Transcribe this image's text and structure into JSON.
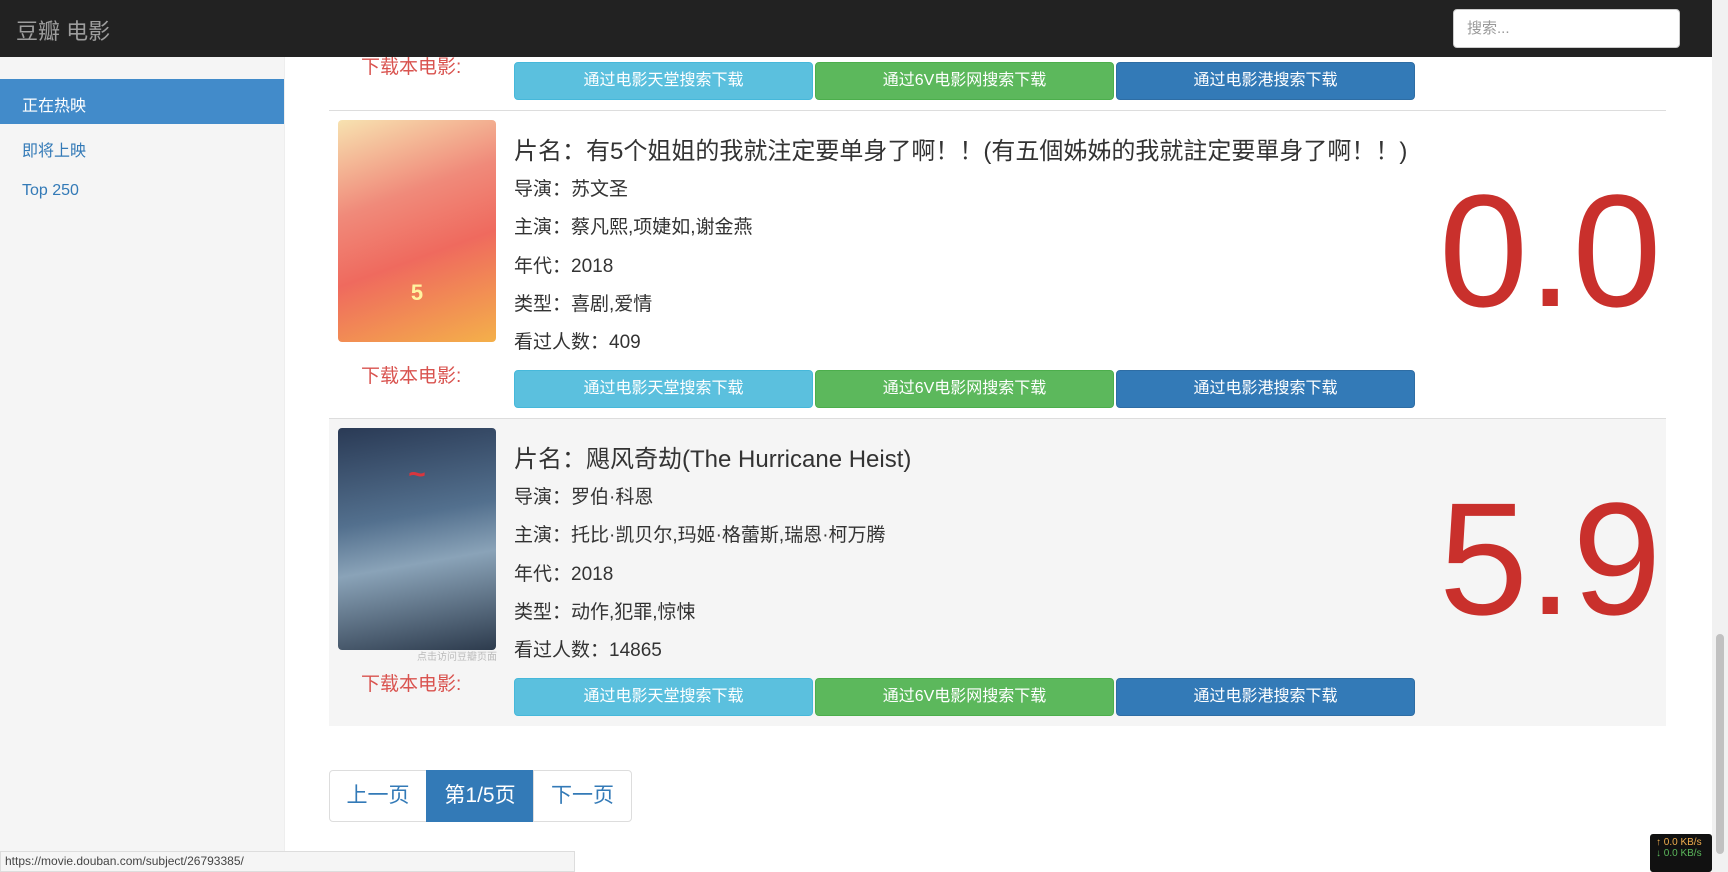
{
  "navbar": {
    "brand": "豆瓣 电影",
    "search_placeholder": "搜索..."
  },
  "sidebar": {
    "items": [
      {
        "label": "正在热映",
        "active": true
      },
      {
        "label": "即将上映",
        "active": false
      },
      {
        "label": "Top 250",
        "active": false
      }
    ]
  },
  "download_label": "下载本电影:",
  "buttons": {
    "tiantang": "通过电影天堂搜索下载",
    "sixv": "通过6V电影网搜索下载",
    "gang": "通过电影港搜索下载"
  },
  "movies": [
    {
      "title": "片名：有5个姐姐的我就注定要单身了啊！！(有五個姊姊的我就註定要單身了啊！！)",
      "director": "导演：苏文圣",
      "cast": "主演：蔡凡熙,项婕如,谢金燕",
      "year": "年代：2018",
      "genre": "类型：喜剧,爱情",
      "viewers": "看过人数：409",
      "rating": "0.0"
    },
    {
      "title": "片名：飓风奇劫(The Hurricane Heist)",
      "director": "导演：罗伯·科恩",
      "cast": "主演：托比·凯贝尔,玛姬·格蕾斯,瑞恩·柯万腾",
      "year": "年代：2018",
      "genre": "类型：动作,犯罪,惊悚",
      "viewers": "看过人数：14865",
      "rating": "5.9",
      "poster_tooltip": "点击访问豆瓣页面"
    }
  ],
  "pager": {
    "prev": "上一页",
    "current": "第1/5页",
    "next": "下一页"
  },
  "status_url": "https://movie.douban.com/subject/26793385/",
  "net": {
    "up": "↑ 0.0 KB/s",
    "down": "↓ 0.0 KB/s"
  },
  "colors": {
    "navbar": "#222222",
    "active": "#428bca",
    "rating": "#c9302c",
    "download_label": "#d9534f"
  }
}
